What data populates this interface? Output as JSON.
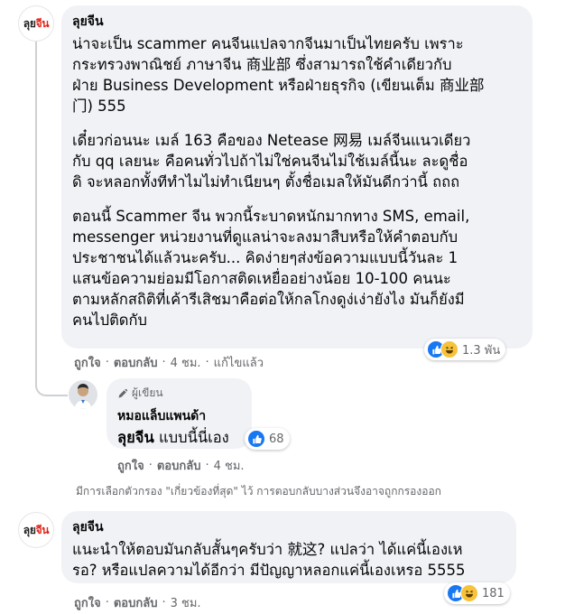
{
  "colors": {
    "brand_red": "#e1251b",
    "like_blue": "#1877f2",
    "bubble_bg": "#f0f2f5",
    "meta_gray": "#65676b"
  },
  "comment1": {
    "avatar_logo": [
      "ลุย",
      "จีน"
    ],
    "author": "ลุยจีน",
    "paragraphs": [
      [
        "น่าจะเป็น scammer คนจีนแปลจากจีนมาเป็นไทยครับ เพราะ",
        "กระทรวงพาณิชย์ ภาษาจีน 商业部 ซึ่งสามารถใช้คำเดียวกับ",
        "ฝ่าย Business Development หรือฝ่ายธุรกิจ (เขียนเต็ม 商业部",
        "门) 555"
      ],
      [
        "เดี๋ยวก่อนนะ เมล์ 163 คือของ Netease 网易 เมล์จีนแนวเดียว",
        "กับ qq เลยนะ คือคนทั่วไปถ้าไม่ใช่คนจีนไม่ใช้เมล์นี้นะ ละดูชื่อ",
        "ดิ จะหลอกทั้งทีทำไมไม่ทำเนียนๆ ตั้งชื่อเมลให้มันดีกว่านี้ ถถถ"
      ],
      [
        "ตอนนี้ Scammer จีน พวกนี้ระบาดหนักมากทาง SMS, email,",
        "messenger หน่วยงานที่ดูแลน่าจะลงมาสืบหรือให้คำตอบกับ",
        "ประชาชนได้แล้วนะครับ... คิดง่ายๆส่งข้อความแบบนี้วันละ 1",
        "แสนข้อความย่อมมีโอกาสติดเหยื่ออย่างน้อย 10-100 คนนะ",
        "ตามหลักสถิติที่เค้ารีเสิชมาคือต่อให้กลโกงดูง่เง่ายังไง มันก็ยังมี",
        "คนไปติดกับ"
      ]
    ],
    "reactions": {
      "count": "1.3 พัน",
      "types": [
        "like-icon",
        "haha-icon"
      ]
    },
    "actions": {
      "like": "ถูกใจ",
      "reply": "ตอบกลับ",
      "time": "4 ชม.",
      "edited": "แก้ไขแล้ว"
    }
  },
  "reply1": {
    "badge": "ผู้เขียน",
    "author": "หมอแล็บแพนด้า",
    "tag": "ลุยจีน",
    "text": "แบบนี้นี่เอง",
    "reactions": {
      "count": "68",
      "types": [
        "like-icon"
      ]
    },
    "actions": {
      "like": "ถูกใจ",
      "reply": "ตอบกลับ",
      "time": "4 ชม."
    }
  },
  "filter_note": "มีการเลือกตัวกรอง \"เกี่ยวข้องที่สุด\" ไว้ การตอบกลับบางส่วนจึงอาจถูกกรองออก",
  "comment2": {
    "avatar_logo": [
      "ลุย",
      "จีน"
    ],
    "author": "ลุยจีน",
    "lines": [
      "แนะนำให้ตอบมันกลับสั้นๆครับว่า 就这? แปลว่า ได้แค่นี้เองเห",
      "รอ? หรือแปลความได้อีกว่า มีปัญญาหลอกแค่นี้เองเหรอ 5555"
    ],
    "reactions": {
      "count": "181",
      "types": [
        "like-icon",
        "haha-icon"
      ]
    },
    "actions": {
      "like": "ถูกใจ",
      "reply": "ตอบกลับ",
      "time": "3 ชม."
    }
  }
}
